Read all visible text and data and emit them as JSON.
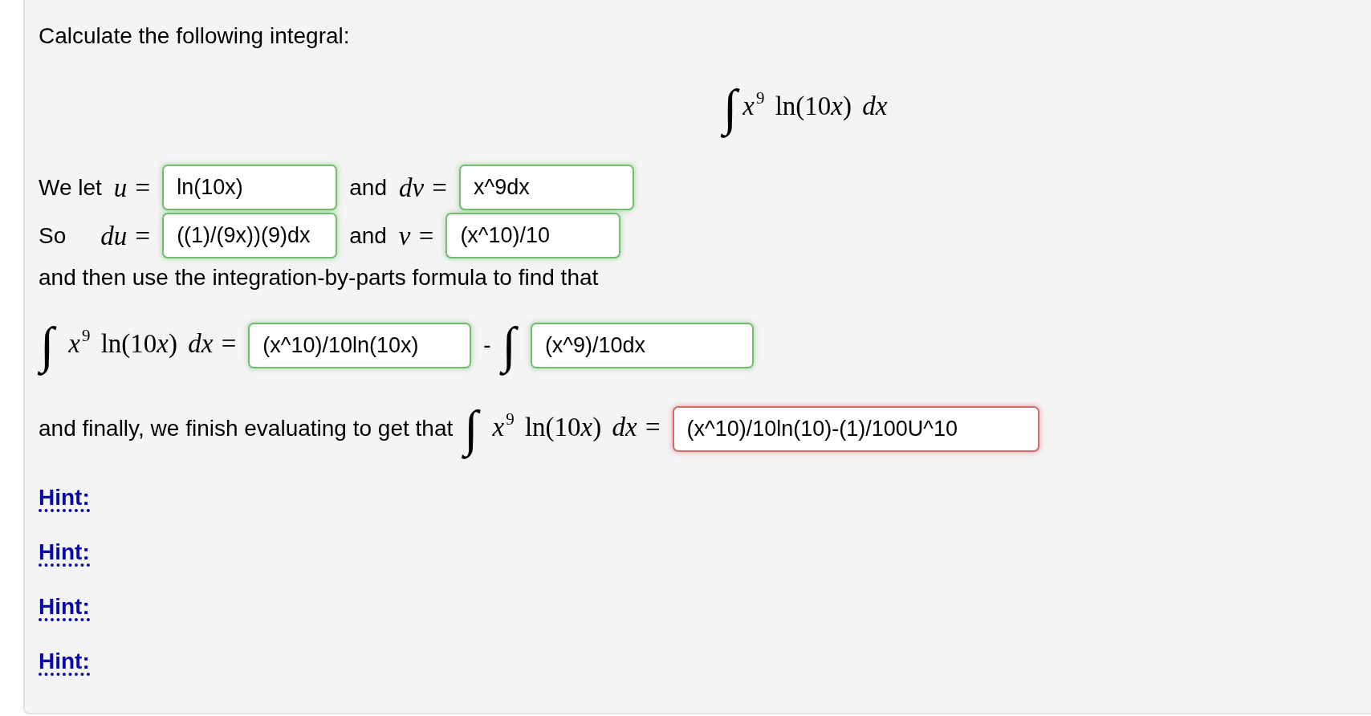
{
  "prompt": "Calculate the following integral:",
  "display_integral": {
    "sign": "∫",
    "integrand": [
      {
        "kind": "var",
        "text": "x"
      },
      {
        "kind": "sup",
        "text": "9"
      },
      {
        "kind": "fn",
        "text": "ln"
      },
      {
        "kind": "sym",
        "text": "(10"
      },
      {
        "kind": "var",
        "text": "x"
      },
      {
        "kind": "sym",
        "text": ")"
      },
      {
        "kind": "diff",
        "text": "dx"
      }
    ]
  },
  "lines": [
    {
      "segments": [
        {
          "kind": "text",
          "text": "We let"
        },
        {
          "kind": "math",
          "tokens": [
            {
              "kind": "var",
              "text": "u"
            },
            {
              "kind": "rel",
              "text": "="
            }
          ]
        },
        {
          "kind": "field",
          "value": "ln(10x)",
          "correct": true
        },
        {
          "kind": "text",
          "text": "and"
        },
        {
          "kind": "math",
          "tokens": [
            {
              "kind": "var",
              "text": "dv"
            },
            {
              "kind": "rel",
              "text": "="
            }
          ]
        },
        {
          "kind": "field",
          "value": "x^9dx",
          "correct": true
        }
      ]
    },
    {
      "segments": [
        {
          "kind": "text",
          "text": "So"
        },
        {
          "kind": "math",
          "tokens": [
            {
              "kind": "quad"
            },
            {
              "kind": "var",
              "text": "du"
            },
            {
              "kind": "rel",
              "text": "="
            }
          ]
        },
        {
          "kind": "field",
          "value": "((1)/(9x))(9)dx",
          "correct": true
        },
        {
          "kind": "text",
          "text": "and"
        },
        {
          "kind": "math",
          "tokens": [
            {
              "kind": "var",
              "text": "v"
            },
            {
              "kind": "rel",
              "text": "="
            }
          ]
        },
        {
          "kind": "field",
          "value": "(x^10)/10",
          "correct": true
        }
      ]
    },
    {
      "segments": [
        {
          "kind": "text",
          "text": "and then use the integration-by-parts formula to find that"
        }
      ]
    },
    {
      "segments": [
        {
          "kind": "integral",
          "sign": "∫"
        },
        {
          "kind": "math",
          "tokens": [
            {
              "kind": "var",
              "text": "x"
            },
            {
              "kind": "sup",
              "text": "9"
            },
            {
              "kind": "fn",
              "text": "ln"
            },
            {
              "kind": "sym",
              "text": "(10"
            },
            {
              "kind": "var",
              "text": "x"
            },
            {
              "kind": "sym",
              "text": ")"
            },
            {
              "kind": "diff",
              "text": "dx"
            },
            {
              "kind": "rel",
              "text": "="
            }
          ]
        },
        {
          "kind": "field",
          "value": "(x^10)/10ln(10x)",
          "correct": true
        },
        {
          "kind": "text",
          "text": "-"
        },
        {
          "kind": "integral",
          "sign": "∫"
        },
        {
          "kind": "field",
          "value": "(x^9)/10dx",
          "correct": true
        }
      ]
    },
    {
      "segments": [
        {
          "kind": "text",
          "text": "and finally, we finish evaluating to get that"
        },
        {
          "kind": "integral",
          "sign": "∫"
        },
        {
          "kind": "math",
          "tokens": [
            {
              "kind": "var",
              "text": "x"
            },
            {
              "kind": "sup",
              "text": "9"
            },
            {
              "kind": "fn",
              "text": "ln"
            },
            {
              "kind": "sym",
              "text": "(10"
            },
            {
              "kind": "var",
              "text": "x"
            },
            {
              "kind": "sym",
              "text": ")"
            },
            {
              "kind": "diff",
              "text": "dx"
            },
            {
              "kind": "rel",
              "text": "="
            }
          ]
        },
        {
          "kind": "field",
          "value": "(x^10)/10ln(10)-(1)/100U^10",
          "correct": false
        }
      ]
    }
  ],
  "hints": [
    {
      "label": "Hint:"
    },
    {
      "label": "Hint:"
    },
    {
      "label": "Hint:"
    },
    {
      "label": "Hint:"
    }
  ]
}
